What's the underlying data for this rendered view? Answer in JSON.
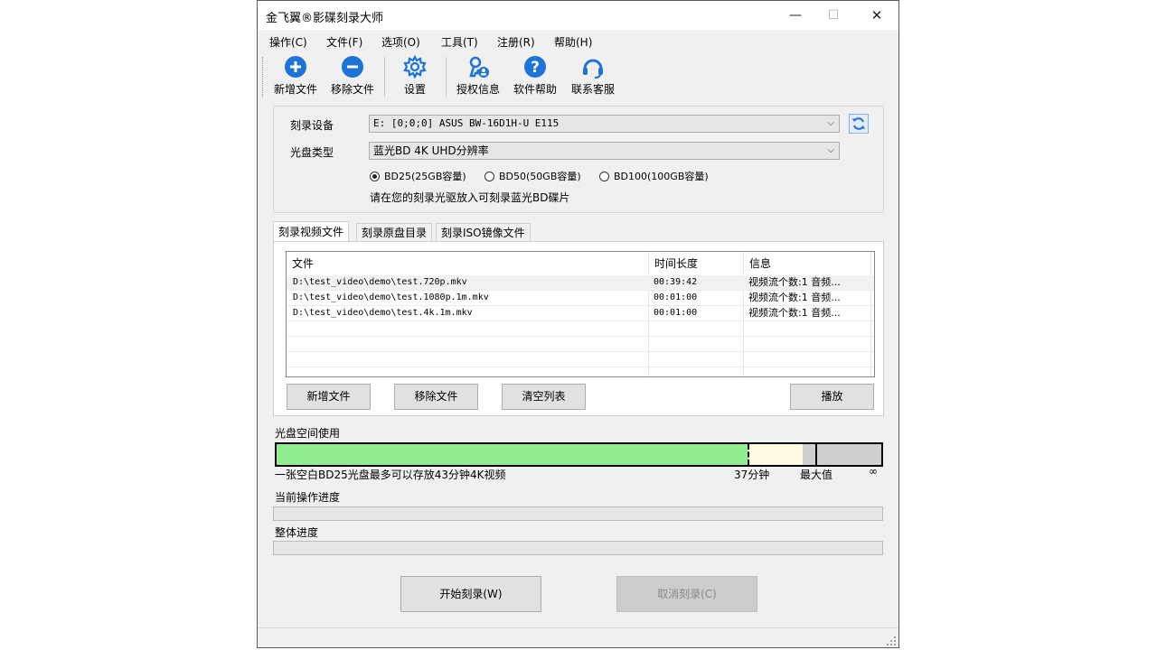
{
  "window": {
    "title": "金飞翼®影碟刻录大师",
    "controls": {
      "minimize": "—",
      "maximize": "☐",
      "close": "✕"
    }
  },
  "menu": [
    "操作(C)",
    "文件(F)",
    "选项(O)",
    "工具(T)",
    "注册(R)",
    "帮助(H)"
  ],
  "toolbar": {
    "add_file": "新增文件",
    "remove_file": "移除文件",
    "settings": "设置",
    "license_info": "授权信息",
    "software_help": "软件帮助",
    "contact_support": "联系客服"
  },
  "device": {
    "label": "刻录设备",
    "value": "E:  [0;0;0] ASUS BW-16D1H-U E115"
  },
  "disc_type": {
    "label": "光盘类型",
    "value": "蓝光BD 4K UHD分辨率",
    "options": [
      {
        "label": "BD25(25GB容量)",
        "selected": true
      },
      {
        "label": "BD50(50GB容量)",
        "selected": false
      },
      {
        "label": "BD100(100GB容量)",
        "selected": false
      }
    ],
    "hint": "请在您的刻录光驱放入可刻录蓝光BD碟片"
  },
  "tabs": [
    "刻录视频文件",
    "刻录原盘目录",
    "刻录ISO镜像文件"
  ],
  "file_list": {
    "columns": [
      "文件",
      "时间长度",
      "信息"
    ],
    "rows": [
      {
        "file": "D:\\test_video\\demo\\test.720p.mkv",
        "duration": "00:39:42",
        "info": "视频流个数:1 音频..."
      },
      {
        "file": "D:\\test_video\\demo\\test.1080p.1m.mkv",
        "duration": "00:01:00",
        "info": "视频流个数:1 音频..."
      },
      {
        "file": "D:\\test_video\\demo\\test.4k.1m.mkv",
        "duration": "00:01:00",
        "info": "视频流个数:1 音频..."
      }
    ]
  },
  "list_buttons": {
    "add": "新增文件",
    "remove": "移除文件",
    "clear": "清空列表",
    "play": "播放"
  },
  "disc_usage": {
    "label": "光盘空间使用",
    "used_fraction": 0.78,
    "note": "一张空白BD25光盘最多可以存放43分钟4K视频",
    "marker_label": "37分钟",
    "max_label": "最大值",
    "infinity": "∞",
    "used_color": "#90ee90",
    "margin_color": "#fffbe0"
  },
  "current_progress": {
    "label": "当前操作进度",
    "value": 0
  },
  "overall_progress": {
    "label": "整体进度",
    "value": 0
  },
  "actions": {
    "start": "开始刻录(W)",
    "cancel": "取消刻录(C)"
  }
}
